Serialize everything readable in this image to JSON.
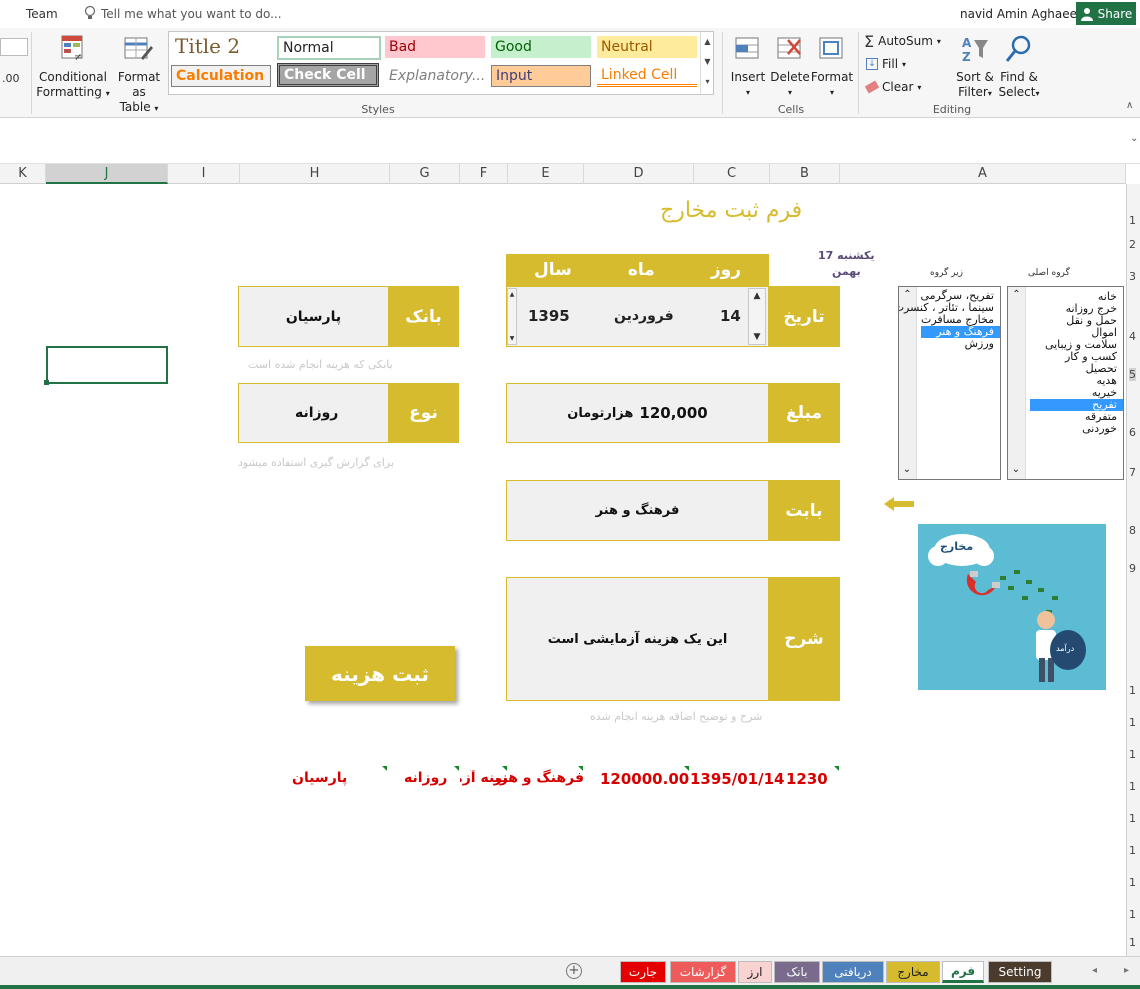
{
  "topbar": {
    "team": "Team",
    "tell_me": "Tell me what you want to do...",
    "user": "navid Amin Aghaee",
    "share": "Share"
  },
  "ribbon": {
    "conditional_formatting": [
      "Conditional",
      "Formatting"
    ],
    "format_as_table": [
      "Format as",
      "Table"
    ],
    "styles": {
      "title2": "Title 2",
      "normal": "Normal",
      "bad": "Bad",
      "good": "Good",
      "neutral": "Neutral",
      "calculation": "Calculation",
      "check_cell": "Check Cell",
      "explanatory": "Explanatory...",
      "input": "Input",
      "linked_cell": "Linked Cell",
      "group_label": "Styles"
    },
    "cells": {
      "insert": "Insert",
      "delete": "Delete",
      "format": "Format",
      "group_label": "Cells"
    },
    "editing": {
      "autosum": "AutoSum",
      "fill": "Fill",
      "clear": "Clear",
      "sort_filter": [
        "Sort &",
        "Filter"
      ],
      "find_select": [
        "Find &",
        "Select"
      ],
      "group_label": "Editing"
    },
    "partial_icon": ".00"
  },
  "columns": [
    "K",
    "J",
    "I",
    "H",
    "G",
    "F",
    "E",
    "D",
    "C",
    "B",
    "A"
  ],
  "rows": [
    "1",
    "2",
    "3",
    "4",
    "5",
    "6",
    "7",
    "8",
    "9",
    "1",
    "1",
    "1",
    "1",
    "1",
    "1",
    "1",
    "1",
    "1"
  ],
  "form": {
    "title": "فرم ثبت مخارج",
    "weekday": "یکشنبه 17",
    "month_name": "بهمن",
    "subgroup_label": "زیر گروه",
    "maingroup_label": "گروه اصلی",
    "date_headers": {
      "year": "سال",
      "month": "ماه",
      "day": "روز"
    },
    "date_label": "تاریخ",
    "date": {
      "day": "14",
      "month": "فروردین",
      "year": "1395"
    },
    "bank_label": "بانک",
    "bank_value": "پارسیان",
    "bank_hint": "بانکی که هزینه انجام شده است",
    "type_label": "نوع",
    "type_value": "روزانه",
    "type_hint": "برای گزارش گیری استفاده میشود",
    "amount_label": "مبلغ",
    "amount_value": "120,000",
    "amount_unit": "هزارتومان",
    "category_label": "بابت",
    "category_value": "فرهنگ و هنر",
    "desc_label": "شرح",
    "desc_value": "این یک هزینه آزمایشی است",
    "desc_hint": "شرح و توضیح اضافه  هزینه انجام شده",
    "submit": "ثبت هزینه",
    "image_caption": "مخارج",
    "bag_text": "درآمد"
  },
  "subgroup_list": [
    "تفریح، سرگرمی",
    "سینما ، تئاتر ، کنسرت",
    "مخارج مسافرت",
    "فرهنگ و هنر",
    "ورزش"
  ],
  "subgroup_selected": 3,
  "maingroup_list": [
    "خانه",
    "خرج روزانه",
    "حمل و نقل",
    "اموال",
    "سلامت و زیبایی",
    "کسب و کار",
    "تحصیل",
    "هدیه",
    "خیریه",
    "تفریح",
    "متفرقه",
    "خوردنی"
  ],
  "maingroup_selected": 9,
  "output_row": {
    "id": "1230",
    "date": "1395/01/14",
    "amount": "120000.00",
    "category": "فرهنگ و هنر",
    "desc_fragment": "زینه آزما",
    "type": "روزانه",
    "bank": "پارسیان"
  },
  "tabs": [
    {
      "label": "Setting",
      "bg": "#4a3b2c",
      "fg": "#ffffff"
    },
    {
      "label": "فرم",
      "bg": "#ffffff",
      "fg": "#217346"
    },
    {
      "label": "مخارج",
      "bg": "#d7bb2e",
      "fg": "#222222"
    },
    {
      "label": "دریافتی",
      "bg": "#4f81bd",
      "fg": "#ffffff"
    },
    {
      "label": "بانک",
      "bg": "#7a6a8c",
      "fg": "#ffffff"
    },
    {
      "label": "ارز",
      "bg": "#f9d2d2",
      "fg": "#222222"
    },
    {
      "label": "گزارشات",
      "bg": "#ef5b5b",
      "fg": "#ffffff"
    },
    {
      "label": "جارت",
      "bg": "#e50000",
      "fg": "#ffffff"
    }
  ],
  "colors": {
    "gold": "#d7bb2e",
    "excel_green": "#217346",
    "output_red": "#d60000",
    "select_blue": "#3399ff"
  }
}
